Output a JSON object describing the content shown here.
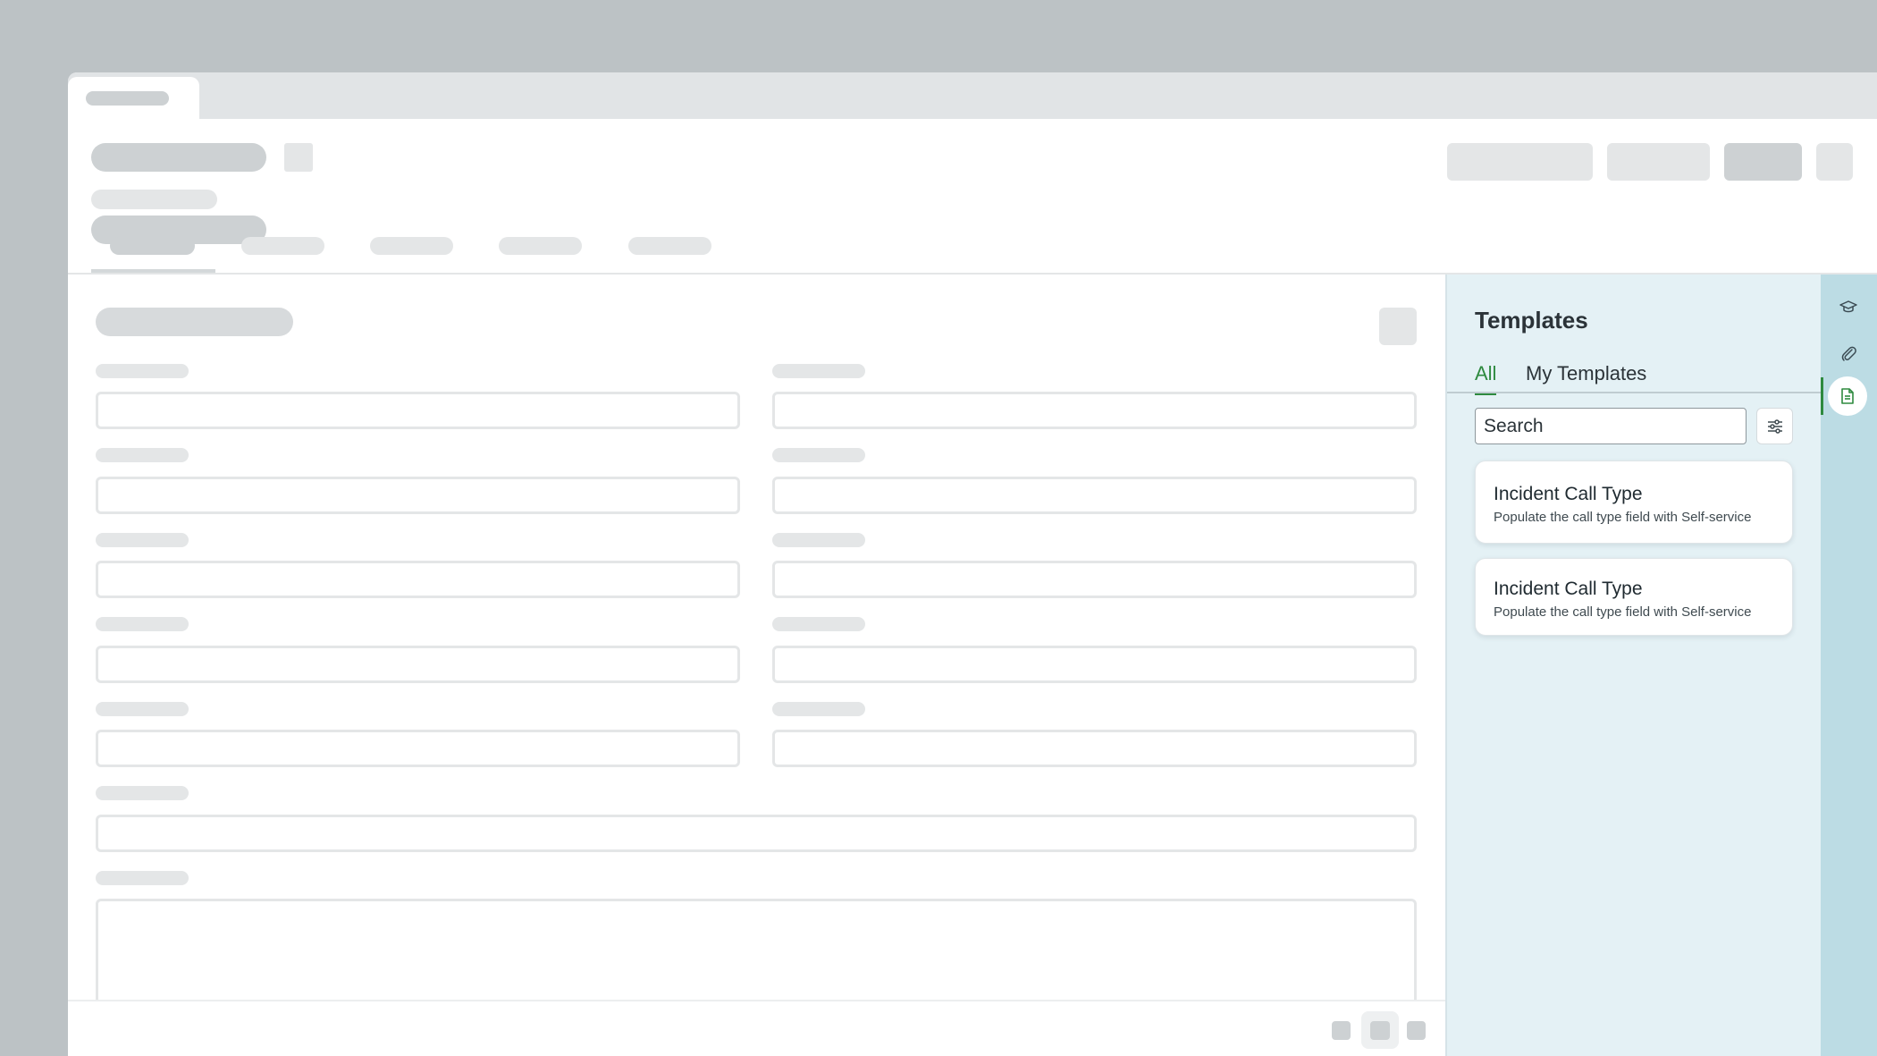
{
  "templates_panel": {
    "title": "Templates",
    "tabs": [
      {
        "label": "All",
        "active": true
      },
      {
        "label": "My Templates",
        "active": false
      }
    ],
    "search": {
      "placeholder": "Search",
      "value": ""
    },
    "cards": [
      {
        "title": "Incident Call Type",
        "description": "Populate the call type field with Self-service"
      },
      {
        "title": "Incident Call Type",
        "description": "Populate the call type field with Self-service"
      }
    ]
  },
  "rail": {
    "items": [
      {
        "icon": "graduation-cap-icon",
        "active": false
      },
      {
        "icon": "paperclip-icon",
        "active": false
      },
      {
        "icon": "document-icon",
        "active": true
      }
    ]
  },
  "colors": {
    "accent": "#2e8a3f",
    "panel_bg": "#e4f1f5",
    "rail_bg": "#bcdce4",
    "skeleton": "#e4e6e7"
  }
}
